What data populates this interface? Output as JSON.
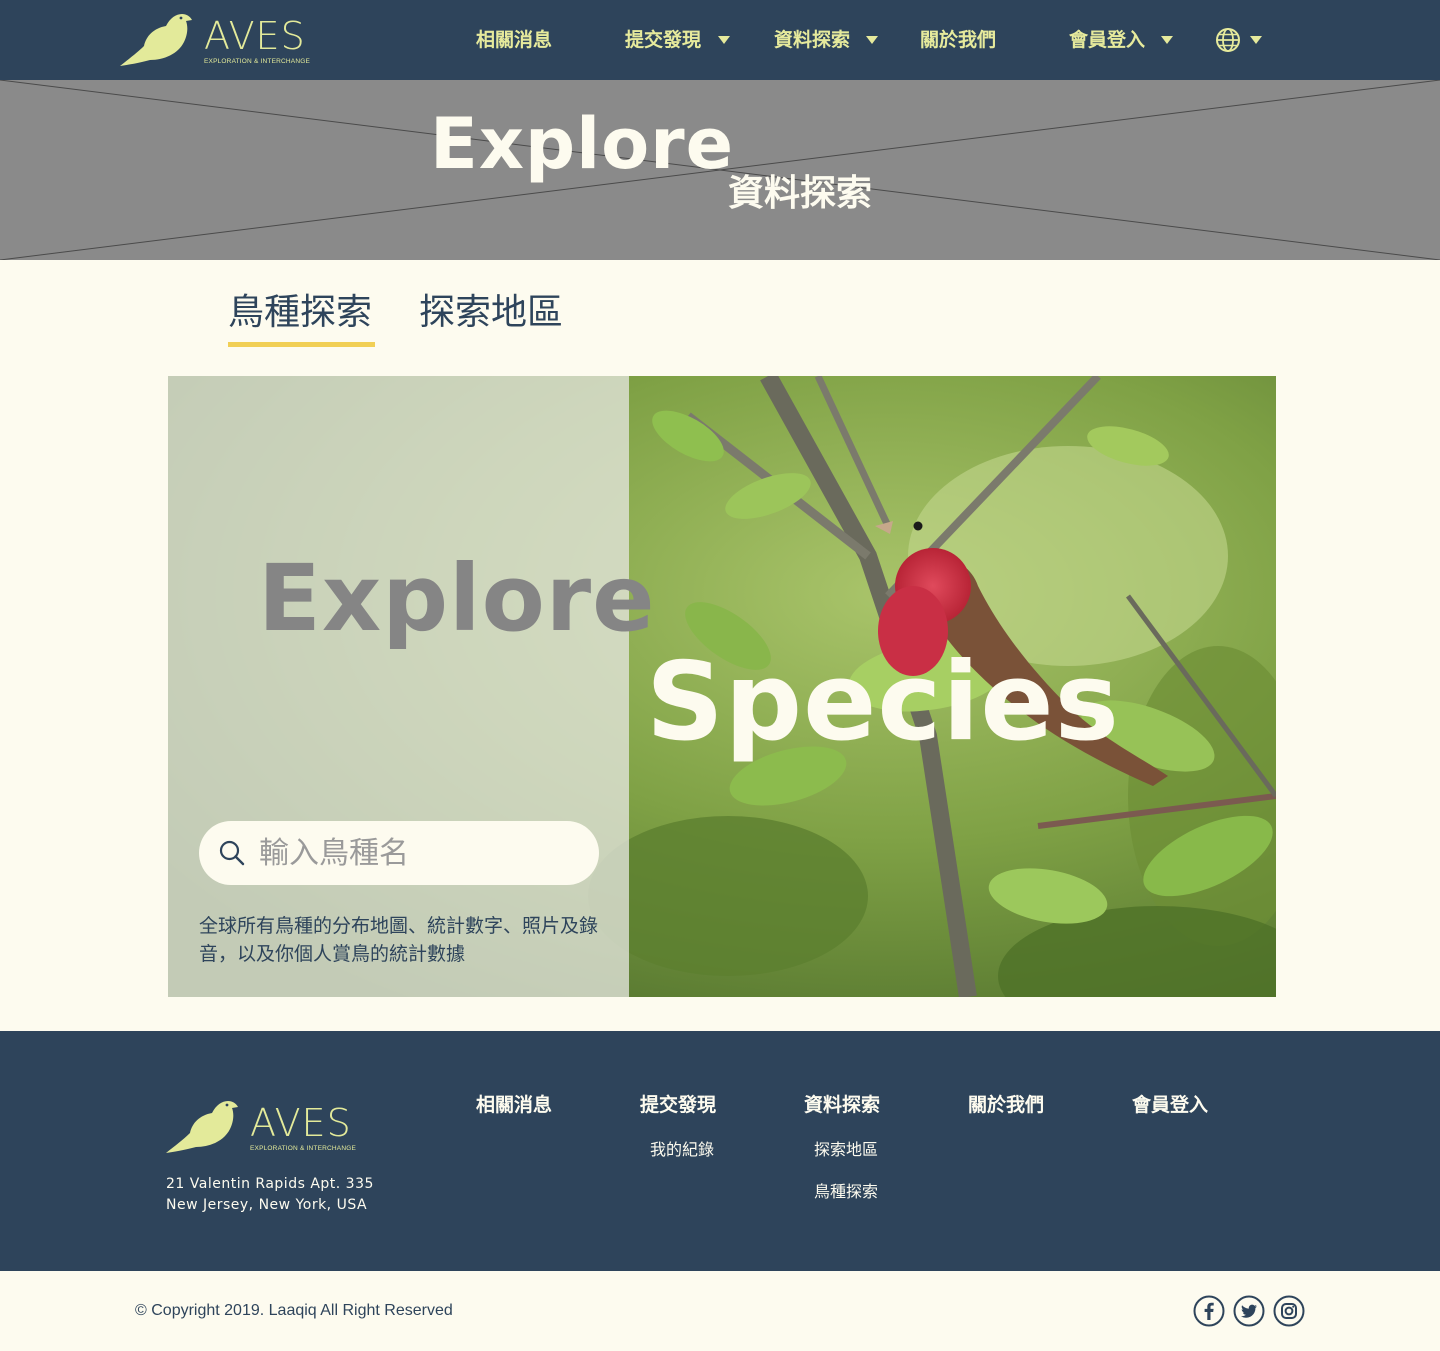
{
  "brand": {
    "name": "AVES",
    "tagline": "EXPLORATION & INTERCHANGE",
    "accent_color": "#e3ea9a",
    "navy_color": "#2e445b",
    "cream_color": "#fdfbef",
    "tab_underline_color": "#f1cf55"
  },
  "nav": {
    "items": [
      {
        "label": "相關消息",
        "has_dropdown": false
      },
      {
        "label": "提交發現",
        "has_dropdown": true
      },
      {
        "label": "資料探索",
        "has_dropdown": true
      },
      {
        "label": "關於我們",
        "has_dropdown": false
      },
      {
        "label": "會員登入",
        "has_dropdown": true
      }
    ],
    "language_icon": "globe-icon"
  },
  "banner": {
    "title": "Explore",
    "subtitle": "資料探索"
  },
  "tabs": {
    "items": [
      {
        "label": "鳥種探索",
        "active": true
      },
      {
        "label": "探索地區",
        "active": false
      }
    ]
  },
  "hero": {
    "title_left": "Explore",
    "title_right": "Species",
    "search": {
      "placeholder": "輸入鳥種名",
      "value": "",
      "icon": "search-icon"
    },
    "description": "全球所有鳥種的分布地圖、統計數字、照片及錄音，以及你個人賞鳥的統計數據"
  },
  "footer": {
    "address_line1": "21 Valentin Rapids Apt. 335",
    "address_line2": "New Jersey, New York, USA",
    "columns": [
      {
        "title": "相關消息",
        "links": []
      },
      {
        "title": "提交發現",
        "links": [
          "我的紀錄"
        ]
      },
      {
        "title": "資料探索",
        "links": [
          "探索地區",
          "鳥種探索"
        ]
      },
      {
        "title": "關於我們",
        "links": []
      },
      {
        "title": "會員登入",
        "links": []
      }
    ]
  },
  "bottom": {
    "copyright": "© Copyright 2019. Laaqiq All Right Reserved",
    "social_icons": [
      "facebook-icon",
      "twitter-icon",
      "instagram-icon"
    ]
  }
}
